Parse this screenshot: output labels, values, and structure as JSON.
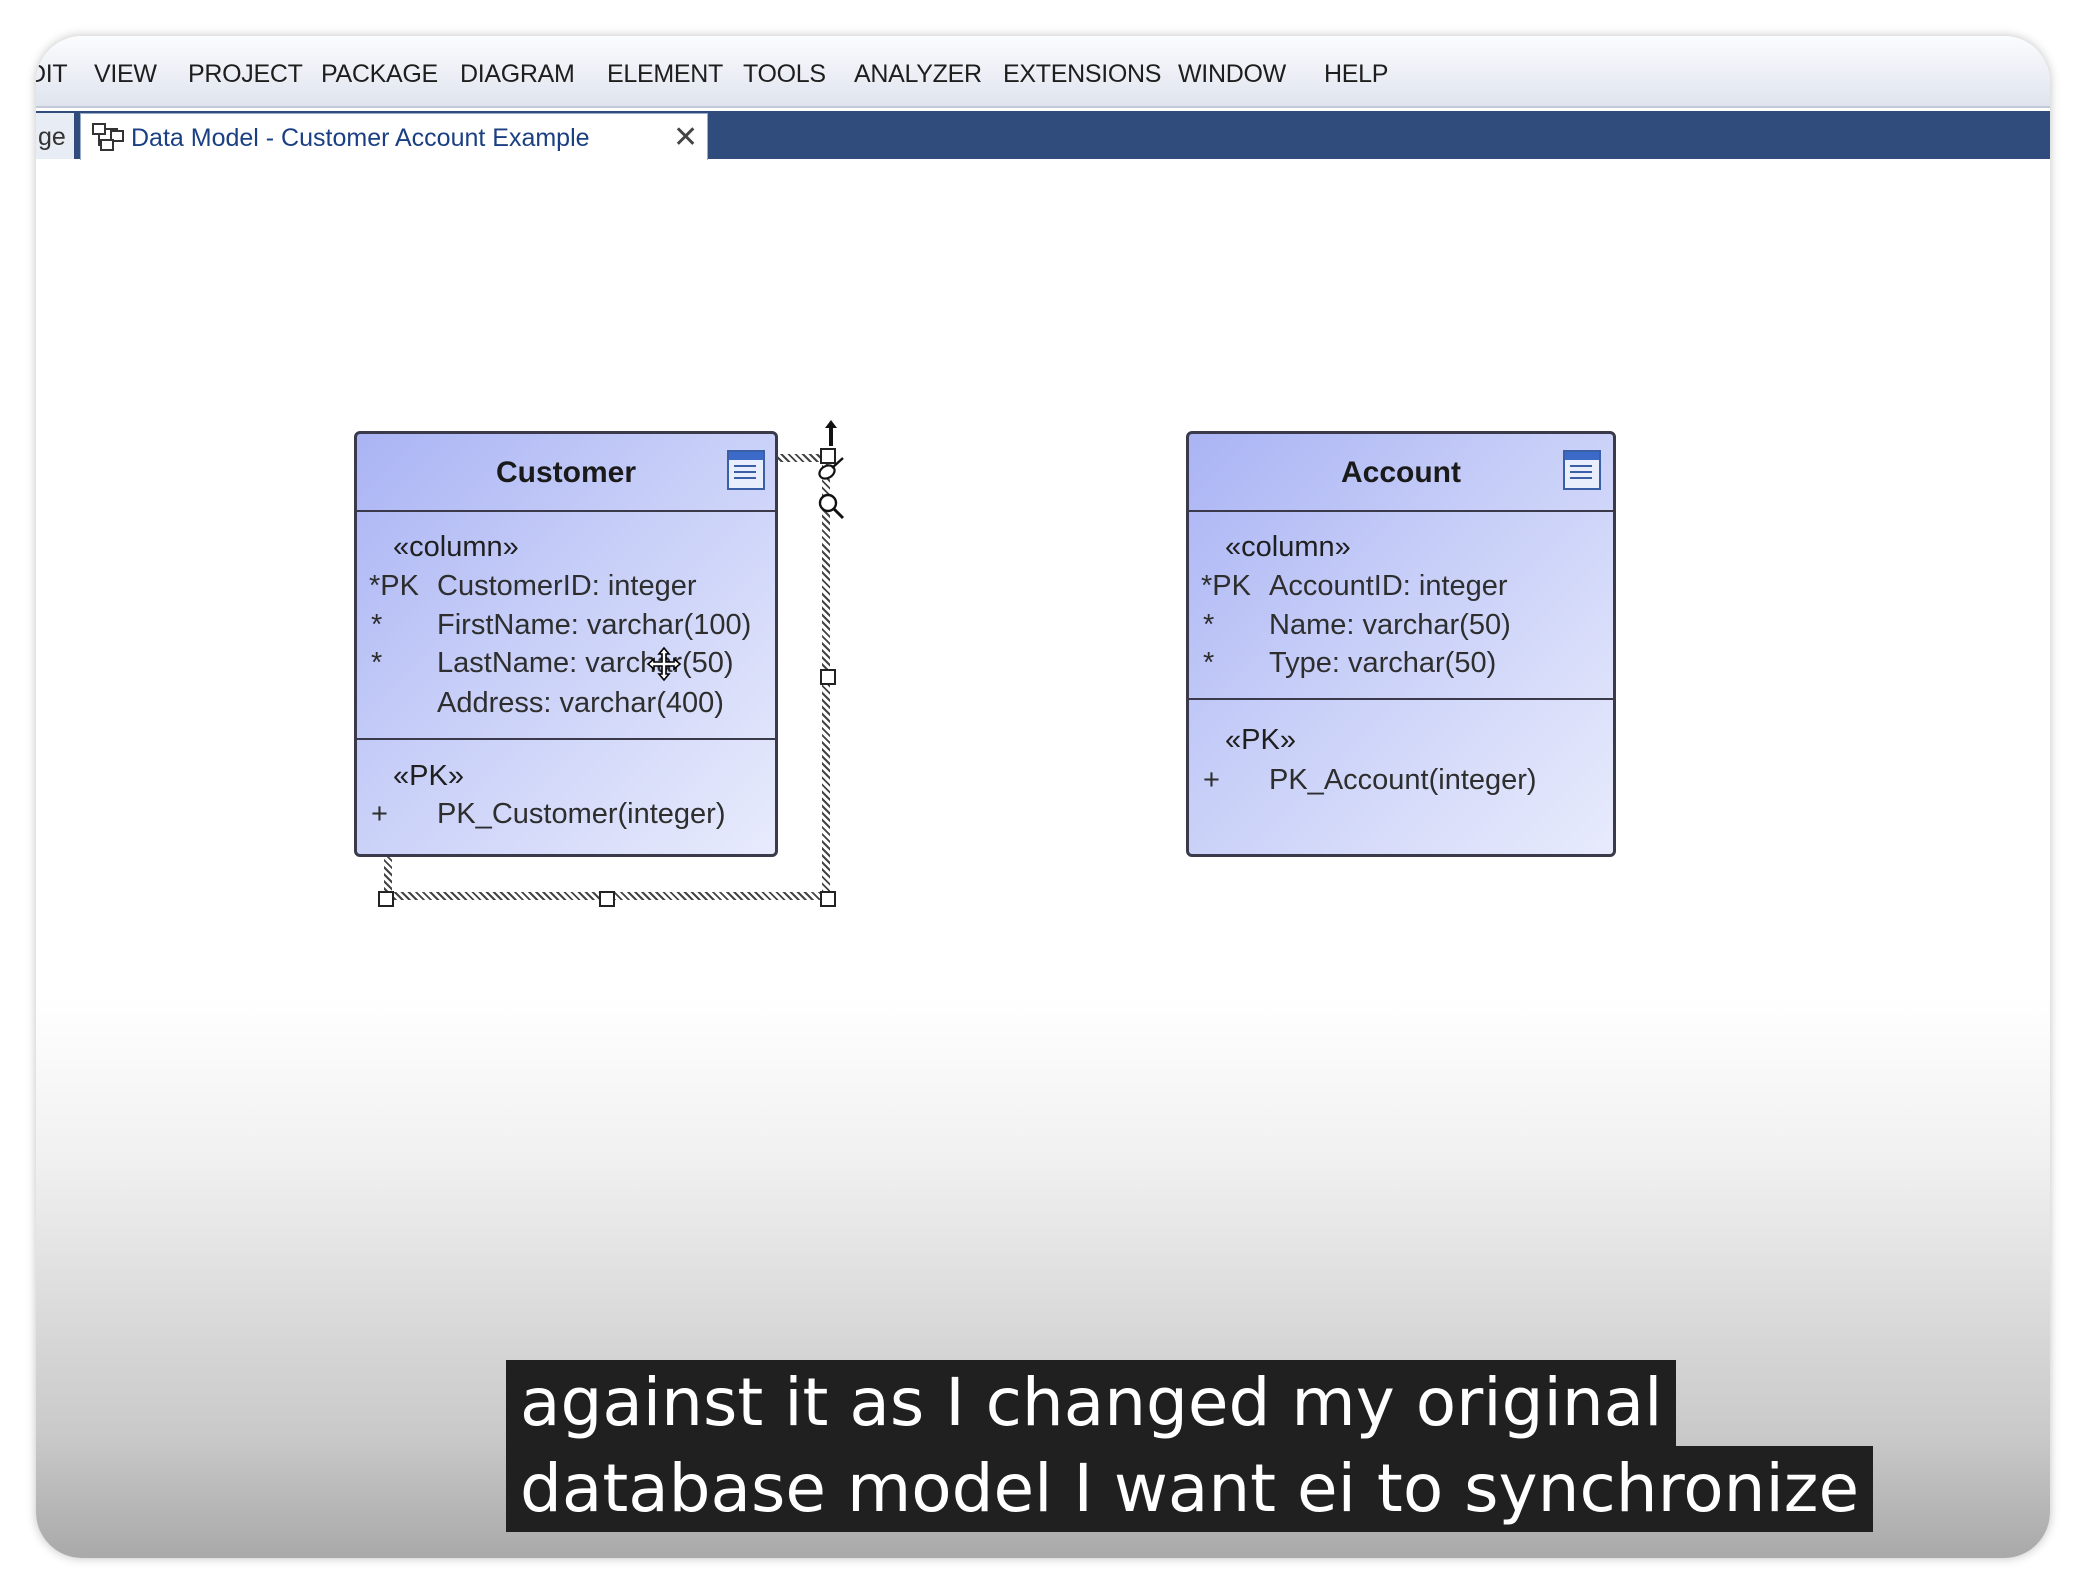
{
  "menubar": {
    "items": [
      "DIT",
      "VIEW",
      "PROJECT",
      "PACKAGE",
      "DIAGRAM",
      "ELEMENT",
      "TOOLS",
      "ANALYZER",
      "EXTENSIONS",
      "WINDOW",
      "HELP"
    ]
  },
  "tabs": {
    "previous_label": "ge",
    "active_label": "Data Model - Customer Account Example",
    "close_glyph": "✕"
  },
  "entities": {
    "customer": {
      "title": "Customer",
      "columns_stereotype": "«column»",
      "columns": [
        {
          "prefix": "*PK",
          "text": "CustomerID: integer"
        },
        {
          "prefix": "*",
          "text": "FirstName: varchar(100)"
        },
        {
          "prefix": "*",
          "text": "LastName: varchar(50)"
        },
        {
          "prefix": "",
          "text": "Address: varchar(400)"
        }
      ],
      "keys_stereotype": "«PK»",
      "keys": [
        {
          "prefix": "+",
          "text": "PK_Customer(integer)"
        }
      ]
    },
    "account": {
      "title": "Account",
      "columns_stereotype": "«column»",
      "columns": [
        {
          "prefix": "*PK",
          "text": "AccountID: integer"
        },
        {
          "prefix": "*",
          "text": "Name: varchar(50)"
        },
        {
          "prefix": "*",
          "text": "Type: varchar(50)"
        }
      ],
      "keys_stereotype": "«PK»",
      "keys": [
        {
          "prefix": "+",
          "text": "PK_Account(integer)"
        }
      ]
    }
  },
  "quick_tools": [
    "arrow-up-icon",
    "brush-icon",
    "magnifier-icon"
  ],
  "subtitles": {
    "line1": "against it as I changed my original",
    "line2": "database model I want ei to synchronize"
  }
}
